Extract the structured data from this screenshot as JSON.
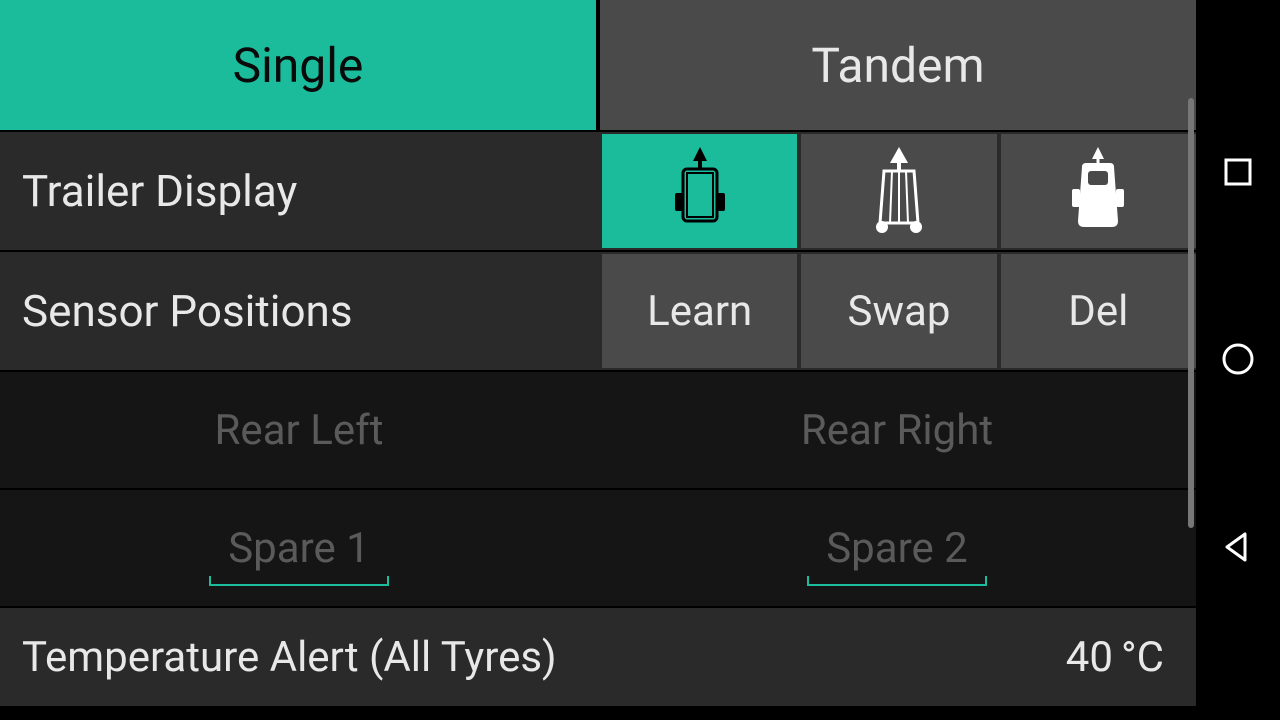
{
  "tabs": {
    "single": "Single",
    "tandem": "Tandem"
  },
  "trailer_display": {
    "label": "Trailer Display",
    "icons": [
      "cargo-trailer-icon",
      "open-trailer-icon",
      "caravan-icon"
    ]
  },
  "sensor_positions": {
    "label": "Sensor Positions",
    "learn": "Learn",
    "swap": "Swap",
    "del": "Del"
  },
  "positions": {
    "rear_left": "Rear Left",
    "rear_right": "Rear Right",
    "spare1": "Spare 1",
    "spare2": "Spare 2"
  },
  "temperature": {
    "label": "Temperature Alert (All Tyres)",
    "value": "40",
    "unit": "°C"
  },
  "nav": {
    "recents": "square",
    "home": "circle",
    "back": "triangle"
  }
}
